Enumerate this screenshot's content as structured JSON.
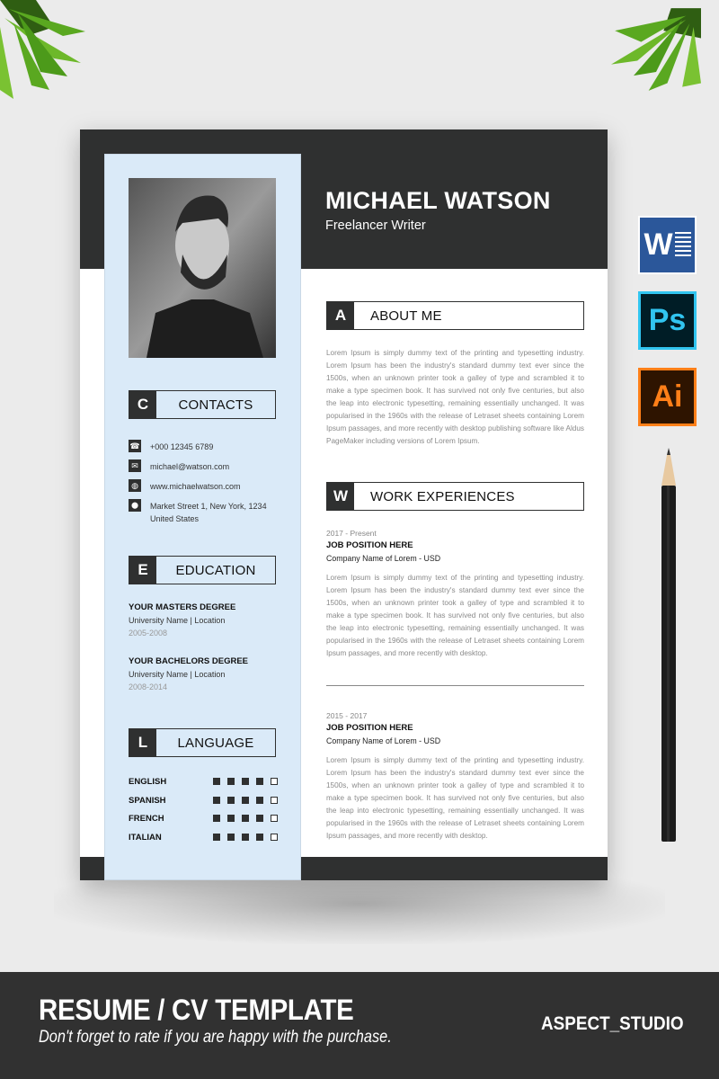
{
  "resume": {
    "name": "MICHAEL WATSON",
    "role": "Freelancer Writer",
    "sidebar": {
      "contacts": {
        "letter": "C",
        "title": "CONTACTS",
        "items": [
          {
            "icon": "phone-icon",
            "glyph": "☎",
            "text": "+000 12345 6789"
          },
          {
            "icon": "email-icon",
            "glyph": "✉",
            "text": "michael@watson.com"
          },
          {
            "icon": "globe-icon",
            "glyph": "◍",
            "text": "www.michaelwatson.com"
          },
          {
            "icon": "location-pin-icon",
            "glyph": "⬤",
            "text": "Market Street 1, New York, 1234 United States"
          }
        ]
      },
      "education": {
        "letter": "E",
        "title": "EDUCATION",
        "items": [
          {
            "degree": "YOUR MASTERS DEGREE",
            "school": "University Name | Location",
            "years": "2005-2008"
          },
          {
            "degree": "YOUR BACHELORS DEGREE",
            "school": "University Name | Location",
            "years": "2008-2014"
          }
        ]
      },
      "language": {
        "letter": "L",
        "title": "LANGUAGE",
        "max_level": 5,
        "items": [
          {
            "name": "ENGLISH",
            "level": 4
          },
          {
            "name": "SPANISH",
            "level": 4
          },
          {
            "name": "FRENCH",
            "level": 4
          },
          {
            "name": "ITALIAN",
            "level": 4
          }
        ]
      }
    },
    "main": {
      "about": {
        "letter": "A",
        "title": "ABOUT ME",
        "text": "Lorem Ipsum is simply dummy text of the printing and typesetting industry. Lorem Ipsum has been the industry's standard dummy text ever since the 1500s, when an unknown printer took a galley of type and scrambled it to make a type specimen book. It has survived not only five centuries, but also the leap into electronic typesetting, remaining essentially unchanged. It was popularised in the 1960s with the release of Letraset sheets containing Lorem Ipsum passages, and more recently with desktop publishing software like Aldus PageMaker including versions of Lorem Ipsum."
      },
      "work": {
        "letter": "W",
        "title": "WORK EXPERIENCES",
        "jobs": [
          {
            "dates": "2017 - Present",
            "position": "JOB POSITION HERE",
            "company": "Company Name of Lorem - USD",
            "text": "Lorem Ipsum is simply dummy text of the printing and typesetting industry. Lorem Ipsum has been the industry's standard dummy text ever since the 1500s, when an unknown printer took a galley of type and scrambled it to make a type specimen book. It has survived not only five centuries, but also the leap into electronic typesetting, remaining essentially unchanged. It was popularised in the 1960s with the release of Letraset sheets containing Lorem Ipsum passages, and more recently with desktop."
          },
          {
            "dates": "2015 - 2017",
            "position": "JOB POSITION HERE",
            "company": "Company Name of Lorem - USD",
            "text": "Lorem Ipsum is simply dummy text of the printing and typesetting industry. Lorem Ipsum has been the industry's standard dummy text ever since the 1500s, when an unknown printer took a galley of type and scrambled it to make a type specimen book. It has survived not only five centuries, but also the leap into electronic typesetting, remaining essentially unchanged. It was popularised in the 1960s with the release of Letraset sheets containing Lorem Ipsum passages, and more recently with desktop."
          }
        ]
      }
    }
  },
  "app_icons": [
    {
      "name": "word",
      "label": "W",
      "color": "#2b579a"
    },
    {
      "name": "photoshop",
      "label": "Ps",
      "color": "#31c5f0"
    },
    {
      "name": "illustrator",
      "label": "Ai",
      "color": "#ff7f18"
    }
  ],
  "footer": {
    "title": "RESUME / CV TEMPLATE",
    "subtitle": "Don't forget to rate if you are happy with the purchase.",
    "brand": "ASPECT_STUDIO"
  },
  "colors": {
    "dark": "#2f3030",
    "sidebar_bg": "#daeaf8",
    "background": "#ebebeb"
  }
}
